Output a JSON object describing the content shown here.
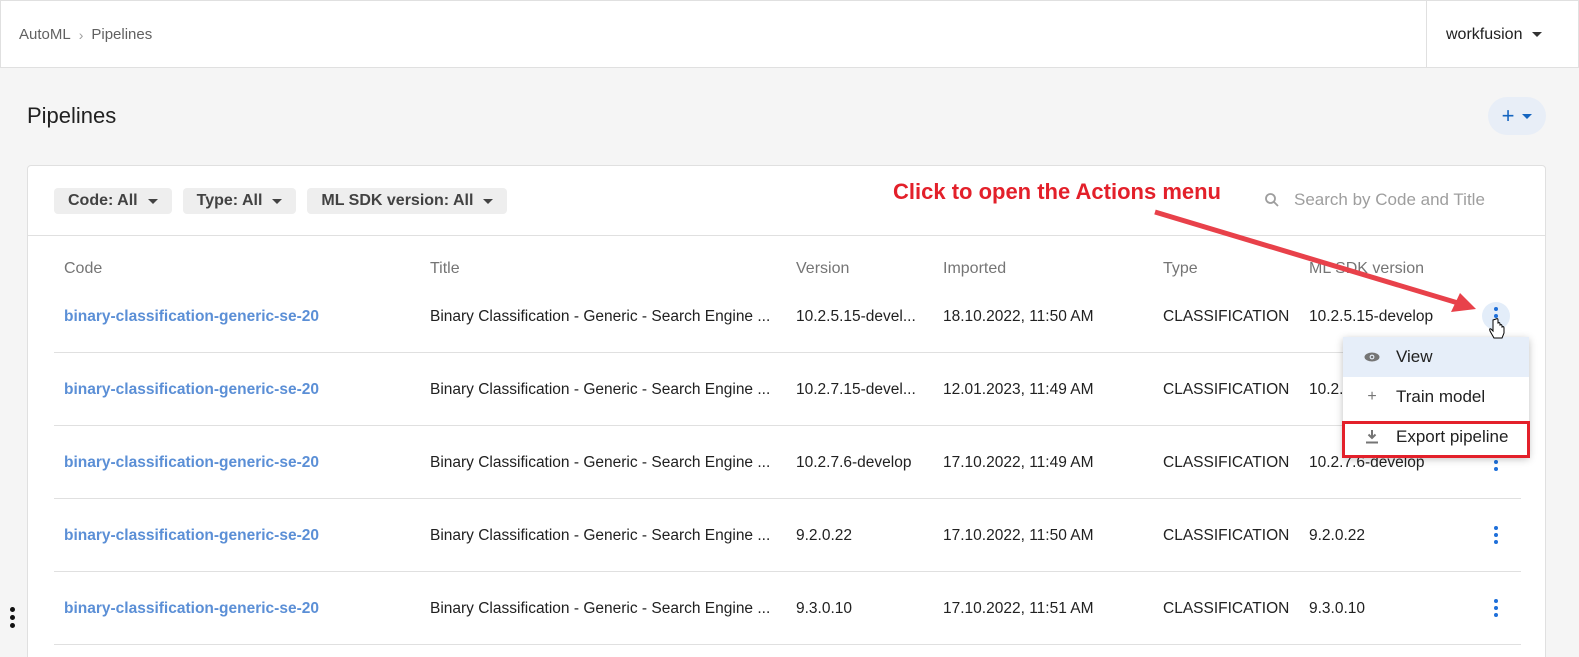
{
  "breadcrumb": {
    "root": "AutoML",
    "current": "Pipelines"
  },
  "tenant": {
    "name": "workfusion"
  },
  "page": {
    "title": "Pipelines",
    "add_icon": "plus-icon"
  },
  "filters": [
    {
      "label": "Code: All"
    },
    {
      "label": "Type: All"
    },
    {
      "label": "ML SDK version: All"
    }
  ],
  "search": {
    "placeholder": "Search by Code and Title"
  },
  "table": {
    "headers": {
      "code": "Code",
      "title": "Title",
      "version": "Version",
      "imported": "Imported",
      "type": "Type",
      "sdk": "ML SDK version"
    },
    "rows": [
      {
        "code": "binary-classification-generic-se-20",
        "title": "Binary Classification - Generic - Search Engine ...",
        "version": "10.2.5.15-devel...",
        "imported": "18.10.2022, 11:50 AM",
        "type": "CLASSIFICATION",
        "sdk": "10.2.5.15-develop"
      },
      {
        "code": "binary-classification-generic-se-20",
        "title": "Binary Classification - Generic - Search Engine ...",
        "version": "10.2.7.15-devel...",
        "imported": "12.01.2023, 11:49 AM",
        "type": "CLASSIFICATION",
        "sdk": "10.2."
      },
      {
        "code": "binary-classification-generic-se-20",
        "title": "Binary Classification - Generic - Search Engine ...",
        "version": "10.2.7.6-develop",
        "imported": "17.10.2022, 11:49 AM",
        "type": "CLASSIFICATION",
        "sdk": "10.2.7.6-develop"
      },
      {
        "code": "binary-classification-generic-se-20",
        "title": "Binary Classification - Generic - Search Engine ...",
        "version": "9.2.0.22",
        "imported": "17.10.2022, 11:50 AM",
        "type": "CLASSIFICATION",
        "sdk": "9.2.0.22"
      },
      {
        "code": "binary-classification-generic-se-20",
        "title": "Binary Classification - Generic - Search Engine ...",
        "version": "9.3.0.10",
        "imported": "17.10.2022, 11:51 AM",
        "type": "CLASSIFICATION",
        "sdk": "9.3.0.10"
      }
    ]
  },
  "actions_menu": {
    "items": [
      {
        "label": "View",
        "icon": "eye-icon"
      },
      {
        "label": "Train model",
        "icon": "plus-icon"
      },
      {
        "label": "Export pipeline",
        "icon": "download-icon"
      }
    ]
  },
  "annotation": {
    "text": "Click to open the Actions menu",
    "color": "#e3202a"
  },
  "colors": {
    "link": "#5b8fd6",
    "accent": "#1e6fd9",
    "highlight_border": "#e3202a"
  }
}
